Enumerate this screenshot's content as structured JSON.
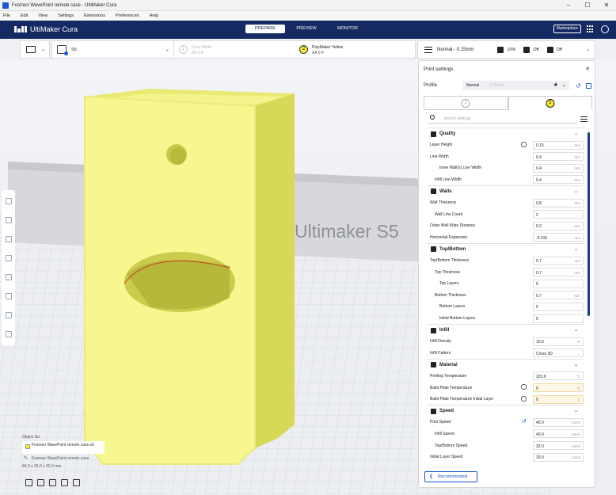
{
  "window": {
    "title": "Fosmon WavePoint remote case - UltiMaker Cura"
  },
  "menu": [
    "File",
    "Edit",
    "View",
    "Settings",
    "Extensions",
    "Preferences",
    "Help"
  ],
  "header": {
    "brand": "UltiMaker Cura",
    "tabs": [
      {
        "label": "PREPARE",
        "active": true
      },
      {
        "label": "PREVIEW",
        "active": false
      },
      {
        "label": "MONITOR",
        "active": false
      }
    ],
    "marketplace": "Marketplace"
  },
  "toolbar": {
    "machine": "S5",
    "extruder1": {
      "material": "Core White",
      "nozzle": "AA 0.8",
      "number": "1"
    },
    "extruder2": {
      "material": "PolyMaker Yellow",
      "nozzle": "AA 0.4",
      "number": "2"
    },
    "profile_summary": "Normal - 0.15mm",
    "infill": "10%",
    "support": "Off",
    "adhesion": "Off"
  },
  "viewport": {
    "bed_brand": "Ultimaker S5"
  },
  "object_list": {
    "header": "Object list",
    "item": "Fosmon WavePoint remote case.stl",
    "file": "Fosmon WavePoint remote case",
    "dimensions": "84.0 x 26.0 x 90.0 mm"
  },
  "panel": {
    "title": "Print settings",
    "profile_label": "Profile",
    "profile_value": "Normal",
    "profile_detail": "- 0.15mm",
    "search_placeholder": "Search settings",
    "recommended": "Recommended"
  },
  "settings": [
    {
      "type": "cat",
      "label": "Quality",
      "icon": "quality-icon"
    },
    {
      "type": "row",
      "label": "Layer Height",
      "value": "0.15",
      "unit": "mm",
      "indent": 0,
      "link": true
    },
    {
      "type": "row",
      "label": "Line Width",
      "value": "0.4",
      "unit": "mm",
      "indent": 0
    },
    {
      "type": "row",
      "label": "Inner Wall(s) Line Width",
      "value": "0.4",
      "unit": "mm",
      "indent": 2
    },
    {
      "type": "row",
      "label": "Infill Line Width",
      "value": "0.4",
      "unit": "mm",
      "indent": 1
    },
    {
      "type": "cat",
      "label": "Walls",
      "icon": "walls-icon"
    },
    {
      "type": "row",
      "label": "Wall Thickness",
      "value": "0.8",
      "unit": "mm",
      "indent": 0
    },
    {
      "type": "row",
      "label": "Wall Line Count",
      "value": "2",
      "unit": "",
      "indent": 1
    },
    {
      "type": "row",
      "label": "Outer Wall Wipe Distance",
      "value": "0.2",
      "unit": "mm",
      "indent": 0
    },
    {
      "type": "row",
      "label": "Horizontal Expansion",
      "value": "-0.015",
      "unit": "mm",
      "indent": 0
    },
    {
      "type": "cat",
      "label": "Top/Bottom",
      "icon": "top-bottom-icon"
    },
    {
      "type": "row",
      "label": "Top/Bottom Thickness",
      "value": "0.7",
      "unit": "mm",
      "indent": 0
    },
    {
      "type": "row",
      "label": "Top Thickness",
      "value": "0.7",
      "unit": "mm",
      "indent": 1
    },
    {
      "type": "row",
      "label": "Top Layers",
      "value": "5",
      "unit": "",
      "indent": 2
    },
    {
      "type": "row",
      "label": "Bottom Thickness",
      "value": "0.7",
      "unit": "mm",
      "indent": 1
    },
    {
      "type": "row",
      "label": "Bottom Layers",
      "value": "5",
      "unit": "",
      "indent": 2
    },
    {
      "type": "row",
      "label": "Initial Bottom Layers",
      "value": "5",
      "unit": "",
      "indent": 2
    },
    {
      "type": "cat",
      "label": "Infill",
      "icon": "infill-icon"
    },
    {
      "type": "row",
      "label": "Infill Density",
      "value": "10.0",
      "unit": "%",
      "indent": 0
    },
    {
      "type": "row",
      "label": "Infill Pattern",
      "value": "Cross 3D",
      "unit": "⌄",
      "indent": 0
    },
    {
      "type": "cat",
      "label": "Material",
      "icon": "material-icon"
    },
    {
      "type": "row",
      "label": "Printing Temperature",
      "value": "223.0",
      "unit": "°C",
      "indent": 0
    },
    {
      "type": "row",
      "label": "Build Plate Temperature",
      "value": "0",
      "unit": "°C",
      "indent": 0,
      "link": true,
      "warn": true
    },
    {
      "type": "row",
      "label": "Build Plate Temperature Initial Layer",
      "value": "0",
      "unit": "°C",
      "indent": 0,
      "link": true,
      "warn": true
    },
    {
      "type": "cat",
      "label": "Speed",
      "icon": "speed-icon"
    },
    {
      "type": "row",
      "label": "Print Speed",
      "value": "40.0",
      "unit": "mm/s",
      "indent": 0,
      "reset": true
    },
    {
      "type": "row",
      "label": "Infill Speed",
      "value": "40.0",
      "unit": "mm/s",
      "indent": 1
    },
    {
      "type": "row",
      "label": "Top/Bottom Speed",
      "value": "32.0",
      "unit": "mm/s",
      "indent": 1
    },
    {
      "type": "row",
      "label": "Initial Layer Speed",
      "value": "30.0",
      "unit": "mm/s",
      "indent": 0
    }
  ]
}
